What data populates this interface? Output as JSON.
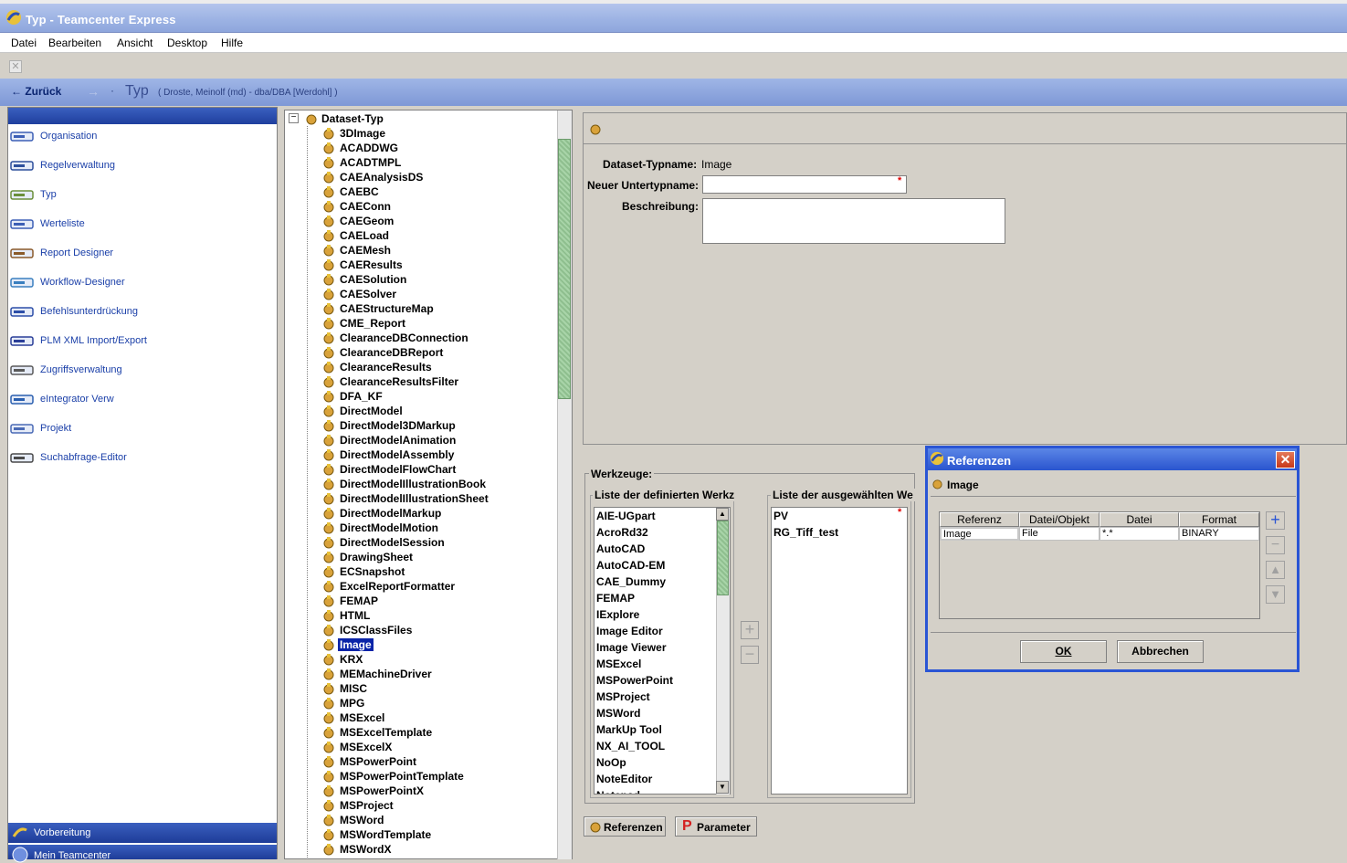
{
  "window": {
    "title": "Typ - Teamcenter Express"
  },
  "menu": [
    "Datei",
    "Bearbeiten",
    "Ansicht",
    "Desktop",
    "Hilfe"
  ],
  "nav": {
    "back_label": "Zurück",
    "page_title": "Typ",
    "user_info": "( Droste, Meinolf (md)  -  dba/DBA   [Werdohl] )"
  },
  "sidebar": {
    "items": [
      {
        "label": "Organisation",
        "icon": "organisation-icon"
      },
      {
        "label": "Regelverwaltung",
        "icon": "rules-icon"
      },
      {
        "label": "Typ",
        "icon": "type-icon"
      },
      {
        "label": "Werteliste",
        "icon": "list-icon"
      },
      {
        "label": "Report Designer",
        "icon": "report-icon"
      },
      {
        "label": "Workflow-Designer",
        "icon": "workflow-icon"
      },
      {
        "label": "Befehlsunterdrückung",
        "icon": "command-icon"
      },
      {
        "label": "PLM XML Import/Export",
        "icon": "plmxml-icon"
      },
      {
        "label": "Zugriffsverwaltung",
        "icon": "access-icon"
      },
      {
        "label": "eIntegrator Verw",
        "icon": "integrator-icon"
      },
      {
        "label": "Projekt",
        "icon": "project-icon"
      },
      {
        "label": "Suchabfrage-Editor",
        "icon": "query-icon"
      }
    ],
    "bottom": [
      {
        "label": "Vorbereitung"
      },
      {
        "label": "Mein Teamcenter"
      }
    ]
  },
  "tree": {
    "root": "Dataset-Typ",
    "items": [
      "3DImage",
      "ACADDWG",
      "ACADTMPL",
      "CAEAnalysisDS",
      "CAEBC",
      "CAEConn",
      "CAEGeom",
      "CAELoad",
      "CAEMesh",
      "CAEResults",
      "CAESolution",
      "CAESolver",
      "CAEStructureMap",
      "CME_Report",
      "ClearanceDBConnection",
      "ClearanceDBReport",
      "ClearanceResults",
      "ClearanceResultsFilter",
      "DFA_KF",
      "DirectModel",
      "DirectModel3DMarkup",
      "DirectModelAnimation",
      "DirectModelAssembly",
      "DirectModelFlowChart",
      "DirectModelIllustrationBook",
      "DirectModelIllustrationSheet",
      "DirectModelMarkup",
      "DirectModelMotion",
      "DirectModelSession",
      "DrawingSheet",
      "ECSnapshot",
      "ExcelReportFormatter",
      "FEMAP",
      "HTML",
      "ICSClassFiles",
      "Image",
      "KRX",
      "MEMachineDriver",
      "MISC",
      "MPG",
      "MSExcel",
      "MSExcelTemplate",
      "MSExcelX",
      "MSPowerPoint",
      "MSPowerPointTemplate",
      "MSPowerPointX",
      "MSProject",
      "MSWord",
      "MSWordTemplate",
      "MSWordX"
    ],
    "selected": "Image"
  },
  "detail": {
    "typename_label": "Dataset-Typname:",
    "typename_value": "Image",
    "subtype_label": "Neuer Untertypname:",
    "subtype_value": "",
    "desc_label": "Beschreibung:",
    "desc_value": ""
  },
  "tools": {
    "group_label": "Werkzeuge:",
    "defined_label": "Liste der definierten Werkz",
    "selected_label": "Liste der ausgewählten We",
    "defined": [
      "AIE-UGpart",
      "AcroRd32",
      "AutoCAD",
      "AutoCAD-EM",
      "CAE_Dummy",
      "FEMAP",
      "IExplore",
      "Image Editor",
      "Image Viewer",
      "MSExcel",
      "MSPowerPoint",
      "MSProject",
      "MSWord",
      "MarkUp Tool",
      "NX_AI_TOOL",
      "NoOp",
      "NoteEditor",
      "Notepad"
    ],
    "selected": [
      "PV",
      "RG_Tiff_test"
    ]
  },
  "buttons": {
    "referenzen": "Referenzen",
    "parameter": "Parameter"
  },
  "dialog": {
    "title": "Referenzen",
    "subtitle": "Image",
    "columns": [
      "Referenz",
      "Datei/Objekt",
      "Datei",
      "Format"
    ],
    "rows": [
      [
        "Image",
        "File",
        "*.*",
        "BINARY"
      ]
    ],
    "ok": "OK",
    "cancel": "Abbrechen"
  },
  "colors": {
    "accent": "#2a55d4",
    "nav": "#7e98d6",
    "link": "#1a3fa8",
    "selection": "#0a24a8"
  }
}
